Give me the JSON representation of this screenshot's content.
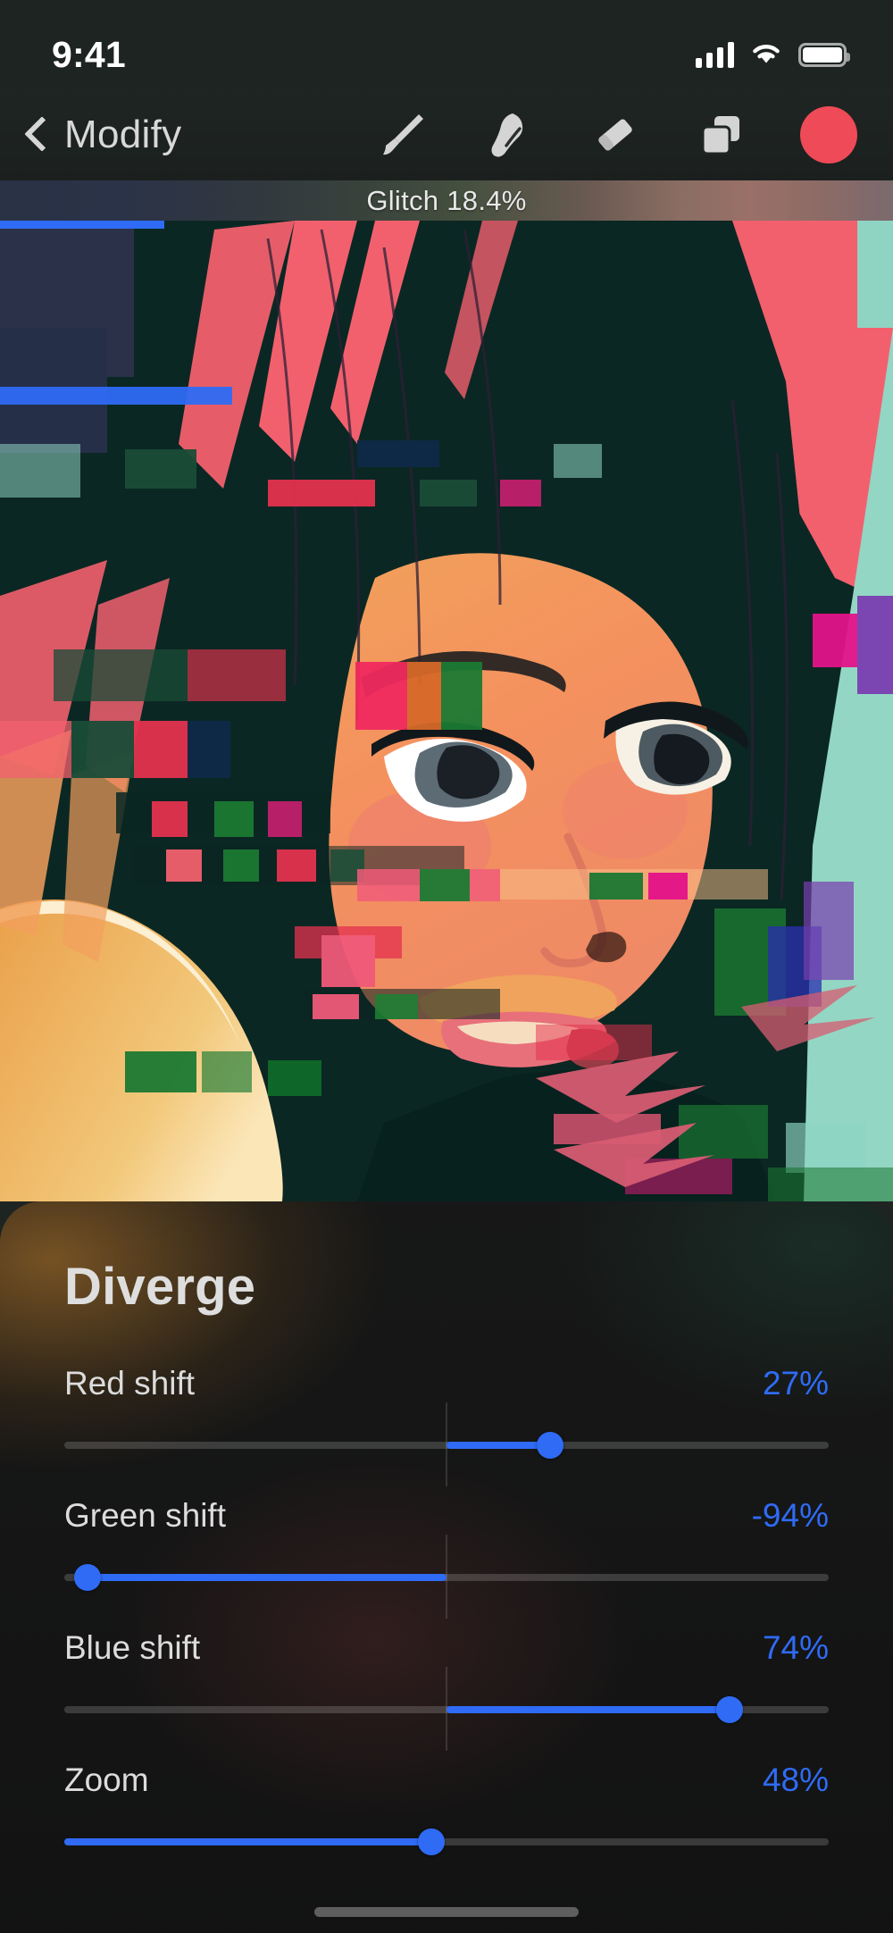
{
  "status_bar": {
    "time": "9:41",
    "cellular_icon": "cellular-signal-icon",
    "wifi_icon": "wifi-icon",
    "battery_icon": "battery-icon"
  },
  "nav_bar": {
    "back_icon": "chevron-left-icon",
    "title": "Modify",
    "tools": [
      {
        "name": "brush-tool",
        "icon": "paintbrush-icon"
      },
      {
        "name": "smudge-tool",
        "icon": "smudge-icon"
      },
      {
        "name": "eraser-tool",
        "icon": "eraser-icon"
      },
      {
        "name": "layers-tool",
        "icon": "layers-icon"
      },
      {
        "name": "color-swatch",
        "icon": "color-circle-icon"
      }
    ],
    "swatch_color": "#ef4a57"
  },
  "effect_header": {
    "label": "Glitch 18.4%",
    "effect_name": "Glitch",
    "percent": 18.4,
    "progress_color": "#2f6bf5"
  },
  "panel": {
    "title": "Diverge",
    "accent_color": "#2f6bf5",
    "sliders": [
      {
        "label": "Red shift",
        "value_text": "27%",
        "value": 27,
        "min": -100,
        "max": 100,
        "bipolar": true
      },
      {
        "label": "Green shift",
        "value_text": "-94%",
        "value": -94,
        "min": -100,
        "max": 100,
        "bipolar": true
      },
      {
        "label": "Blue shift",
        "value_text": "74%",
        "value": 74,
        "min": -100,
        "max": 100,
        "bipolar": true
      },
      {
        "label": "Zoom",
        "value_text": "48%",
        "value": 48,
        "min": 0,
        "max": 100,
        "bipolar": false
      }
    ]
  },
  "home_indicator": {
    "name": "home-indicator"
  }
}
